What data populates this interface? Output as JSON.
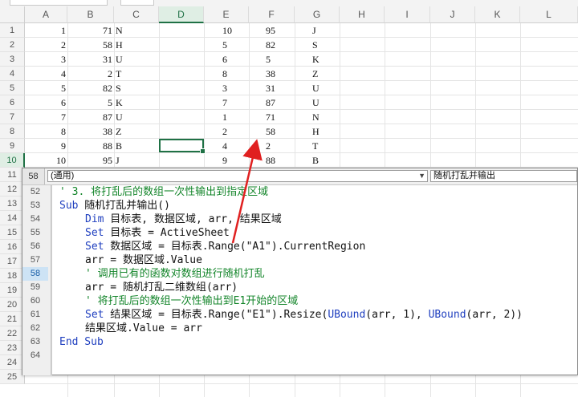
{
  "columns": [
    "A",
    "B",
    "C",
    "D",
    "E",
    "F",
    "G",
    "H",
    "I",
    "J",
    "K",
    "L"
  ],
  "active_column": "D",
  "rows": [
    "1",
    "2",
    "3",
    "4",
    "5",
    "6",
    "7",
    "8",
    "9",
    "10",
    "11",
    "12",
    "13",
    "14",
    "15",
    "16",
    "17",
    "18",
    "19",
    "20",
    "21",
    "22",
    "23",
    "24",
    "25"
  ],
  "active_row": "10",
  "sheet": {
    "colA": [
      "1",
      "2",
      "3",
      "4",
      "5",
      "6",
      "7",
      "8",
      "9",
      "10"
    ],
    "colB": [
      "71",
      "58",
      "31",
      "2",
      "82",
      "5",
      "87",
      "38",
      "88",
      "95"
    ],
    "colC": [
      "N",
      "H",
      "U",
      "T",
      "S",
      "K",
      "U",
      "Z",
      "B",
      "J"
    ],
    "colE": [
      "10",
      "5",
      "6",
      "8",
      "3",
      "7",
      "1",
      "2",
      "4",
      "9"
    ],
    "colF": [
      "95",
      "82",
      "5",
      "38",
      "31",
      "87",
      "71",
      "58",
      "2",
      "88"
    ],
    "colG": [
      "J",
      "S",
      "K",
      "Z",
      "U",
      "U",
      "N",
      "H",
      "T",
      "B"
    ]
  },
  "vbe": {
    "current_line": "58",
    "object_combo": "(通用)",
    "procedure_combo": "随机打乱并输出",
    "line_numbers": [
      "52",
      "53",
      "54",
      "55",
      "56",
      "57",
      "58",
      "59",
      "60",
      "61",
      "62",
      "63",
      "64"
    ],
    "active_line_index": 6,
    "code": {
      "l52": "' 3. 将打乱后的数组一次性输出到指定区域",
      "l53_kw": "Sub",
      "l53_rest": " 随机打乱并输出()",
      "l54_kw": "Dim",
      "l54_rest": " 目标表, 数据区域, arr, 结果区域",
      "l55_kw": "Set",
      "l55_rest": " 目标表 = ActiveSheet",
      "l56_kw": "Set",
      "l56_rest": " 数据区域 = 目标表.Range(\"A1\").CurrentRegion",
      "l57": "arr = 数据区域.Value",
      "l58": "' 调用已有的函数对数组进行随机打乱",
      "l59": "arr = 随机打乱二维数组(arr)",
      "l60": "' 将打乱后的数组一次性输出到E1开始的区域",
      "l61_kw": "Set",
      "l61_mid": " 结果区域 = 目标表.Range(\"E1\").Resize(",
      "l61_kw2": "UBound",
      "l61_mid2": "(arr, 1), ",
      "l61_kw3": "UBound",
      "l61_end": "(arr, 2))",
      "l62": "结果区域.Value = arr",
      "l63_kw": "End Sub"
    }
  },
  "colors": {
    "accent": "#1f7145",
    "keyword": "#1f3fbf",
    "comment": "#13852a",
    "annotation_arrow": "#e02020"
  }
}
